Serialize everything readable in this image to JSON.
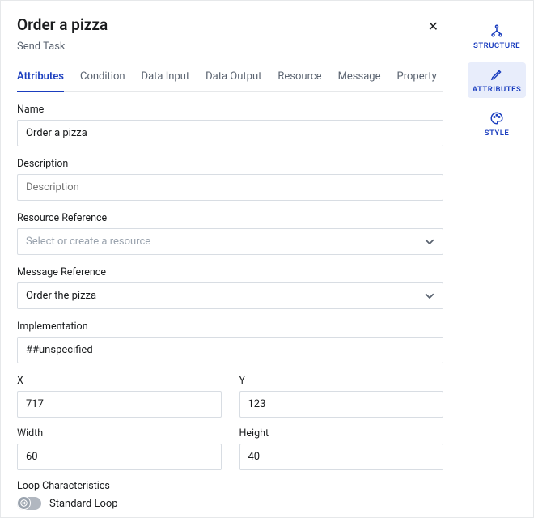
{
  "header": {
    "title": "Order a pizza",
    "subtitle": "Send Task"
  },
  "tabs": {
    "items": [
      {
        "label": "Attributes"
      },
      {
        "label": "Condition"
      },
      {
        "label": "Data Input"
      },
      {
        "label": "Data Output"
      },
      {
        "label": "Resource"
      },
      {
        "label": "Message"
      },
      {
        "label": "Property"
      }
    ]
  },
  "fields": {
    "name": {
      "label": "Name",
      "value": "Order a pizza"
    },
    "description": {
      "label": "Description",
      "placeholder": "Description"
    },
    "resourceRef": {
      "label": "Resource Reference",
      "placeholder": "Select or create a resource"
    },
    "messageRef": {
      "label": "Message Reference",
      "value": "Order the pizza"
    },
    "implementation": {
      "label": "Implementation",
      "value": "##unspecified"
    },
    "x": {
      "label": "X",
      "value": "717"
    },
    "y": {
      "label": "Y",
      "value": "123"
    },
    "width": {
      "label": "Width",
      "value": "60"
    },
    "height": {
      "label": "Height",
      "value": "40"
    }
  },
  "loop": {
    "section": "Loop Characteristics",
    "standard_label": "Standard Loop",
    "standard_enabled": false
  },
  "sidebar": {
    "items": [
      {
        "label": "STRUCTURE",
        "icon": "structure-icon"
      },
      {
        "label": "ATTRIBUTES",
        "icon": "edit-icon"
      },
      {
        "label": "STYLE",
        "icon": "palette-icon"
      }
    ]
  },
  "colors": {
    "accent": "#1b3ebf"
  }
}
